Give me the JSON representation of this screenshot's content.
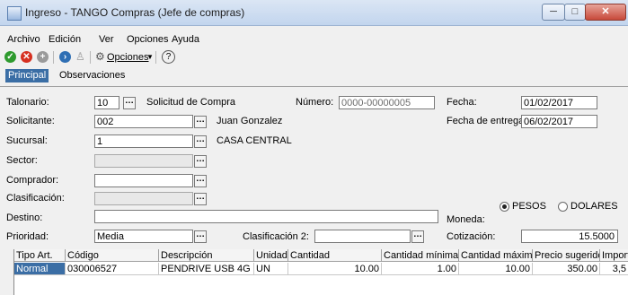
{
  "window": {
    "title": "Ingreso - TANGO Compras (Jefe de compras)",
    "minimize_glyph": "─",
    "maximize_glyph": "□",
    "close_glyph": "✕"
  },
  "menu": [
    {
      "label": "Archivo"
    },
    {
      "label": "Edición"
    },
    {
      "label": "Ver"
    },
    {
      "label": "Opciones"
    },
    {
      "label": "Ayuda"
    }
  ],
  "toolbar": {
    "options_label": "Opciones",
    "icons": [
      "check-icon",
      "cancel-icon",
      "add-icon",
      "search-circle-icon",
      "users-icon",
      "gear-icon",
      "help-icon"
    ],
    "colors": {
      "check": "#2e9a2e",
      "cancel": "#d63020",
      "add": "#9a9a9a",
      "search": "#2f6fb4"
    }
  },
  "tabs": [
    {
      "label": "Principal",
      "active": true
    },
    {
      "label": "Observaciones",
      "active": false
    }
  ],
  "form": {
    "talonario": {
      "label": "Talonario:",
      "value": "10",
      "desc": "Solicitud de Compra"
    },
    "numero": {
      "label": "Número:",
      "value": "0000-00000005"
    },
    "fecha": {
      "label": "Fecha:",
      "value": "01/02/2017"
    },
    "solicitante": {
      "label": "Solicitante:",
      "value": "002",
      "desc": "Juan Gonzalez"
    },
    "fecha_entrega": {
      "label": "Fecha de entrega:",
      "value": "06/02/2017"
    },
    "sucursal": {
      "label": "Sucursal:",
      "value": "1",
      "desc": "CASA CENTRAL"
    },
    "sector": {
      "label": "Sector:",
      "value": ""
    },
    "comprador": {
      "label": "Comprador:",
      "value": ""
    },
    "clasificacion": {
      "label": "Clasificación:",
      "value": ""
    },
    "destino": {
      "label": "Destino:",
      "value": ""
    },
    "moneda": {
      "label": "Moneda:",
      "options": [
        "PESOS",
        "DOLARES"
      ],
      "selected": "PESOS"
    },
    "prioridad": {
      "label": "Prioridad:",
      "value": "Media"
    },
    "clasificacion2": {
      "label": "Clasificación 2:",
      "value": ""
    },
    "cotizacion": {
      "label": "Cotización:",
      "value": "15.5000"
    }
  },
  "grid": {
    "columns": [
      "Tipo Art.",
      "Código",
      "Descripción",
      "Unidad",
      "Cantidad",
      "Cantidad mínima",
      "Cantidad máxima",
      "Precio sugerido",
      "Importe"
    ],
    "rows": [
      [
        "Normal",
        "030006527",
        "PENDRIVE USB 4G",
        "UN",
        "10.00",
        "1.00",
        "10.00",
        "350.00",
        "3,5"
      ]
    ]
  }
}
